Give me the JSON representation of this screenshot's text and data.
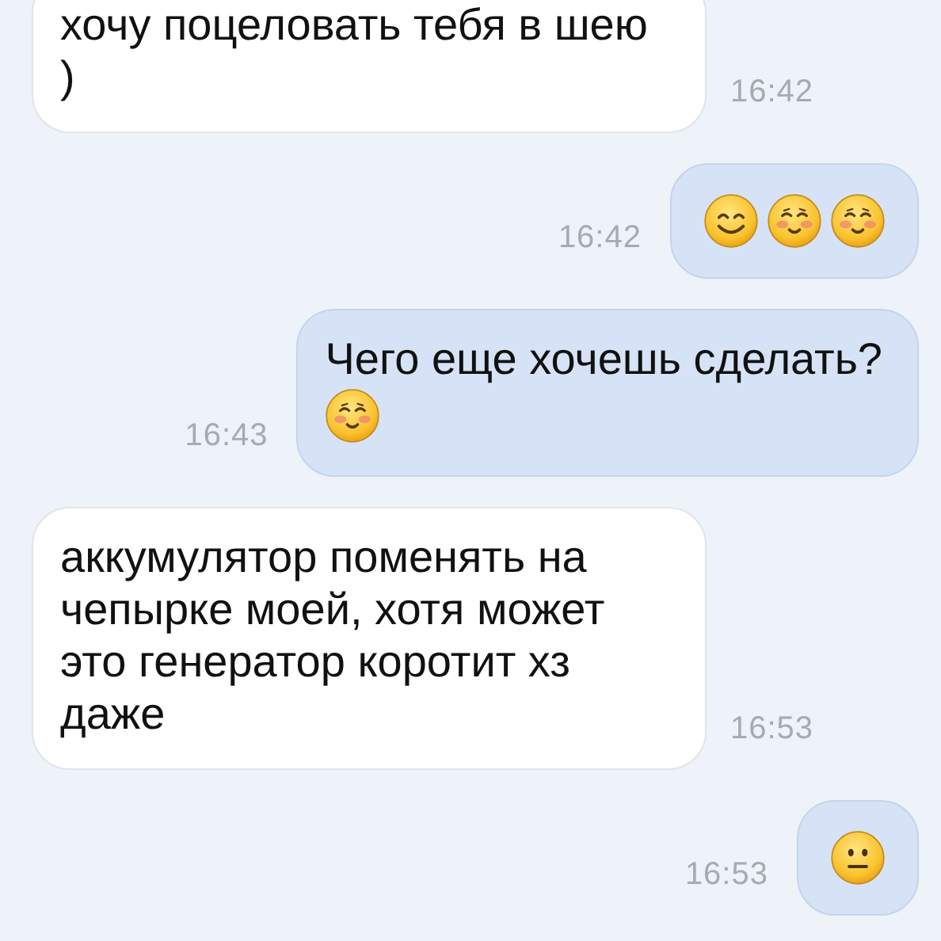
{
  "messages": [
    {
      "kind": "received",
      "text": "хочу поцеловать тебя в шею )",
      "time": "16:42"
    },
    {
      "kind": "sent",
      "emojis": [
        {
          "kind": "smile"
        },
        {
          "kind": "blush"
        },
        {
          "kind": "blush"
        }
      ],
      "time": "16:42"
    },
    {
      "kind": "sent",
      "text": "Чего еще хочешь сделать?",
      "emojis": [
        {
          "kind": "blush"
        }
      ],
      "time": "16:43"
    },
    {
      "kind": "received",
      "text": "аккумулятор поменять на чепырке моей, хотя может это генератор коротит хз даже",
      "time": "16:53"
    },
    {
      "kind": "sent",
      "emojis": [
        {
          "kind": "neutral"
        }
      ],
      "time": "16:53"
    }
  ]
}
